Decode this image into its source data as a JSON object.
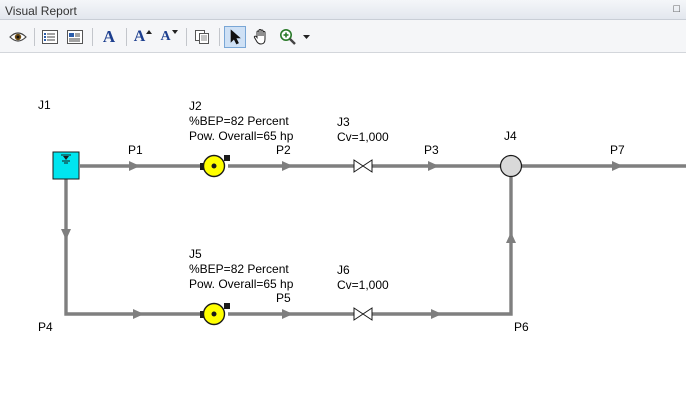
{
  "window": {
    "title": "Visual Report",
    "pin_glyph": "□"
  },
  "toolbar": {
    "buttons": [
      {
        "name": "show-eye-icon"
      },
      {
        "name": "list-view-icon"
      },
      {
        "name": "text-view-icon"
      },
      {
        "name": "font-icon",
        "glyph": "A"
      },
      {
        "name": "font-grow-icon",
        "glyph": "A"
      },
      {
        "name": "font-shrink-icon",
        "glyph": "A"
      },
      {
        "name": "copy-icon"
      },
      {
        "name": "select-arrow-icon"
      },
      {
        "name": "pan-hand-icon"
      },
      {
        "name": "zoom-icon"
      },
      {
        "name": "dropdown-arrow-icon"
      }
    ]
  },
  "diagram": {
    "colors": {
      "pipe": "#7f7f7f",
      "reservoir": "#00e5ef",
      "pump": "#ffff00",
      "junction": "#d9d9d9"
    },
    "junctions": {
      "J1": {
        "name": "J1"
      },
      "J2": {
        "name": "J2",
        "line1": "%BEP=82 Percent",
        "line2": "Pow. Overall=65 hp"
      },
      "J3": {
        "name": "J3",
        "line1": "Cv=1,000"
      },
      "J4": {
        "name": "J4"
      },
      "J5": {
        "name": "J5",
        "line1": "%BEP=82 Percent",
        "line2": "Pow. Overall=65 hp"
      },
      "J6": {
        "name": "J6",
        "line1": "Cv=1,000"
      }
    },
    "pipes": {
      "P1": "P1",
      "P2": "P2",
      "P3": "P3",
      "P4": "P4",
      "P5": "P5",
      "P6": "P6",
      "P7": "P7"
    }
  }
}
